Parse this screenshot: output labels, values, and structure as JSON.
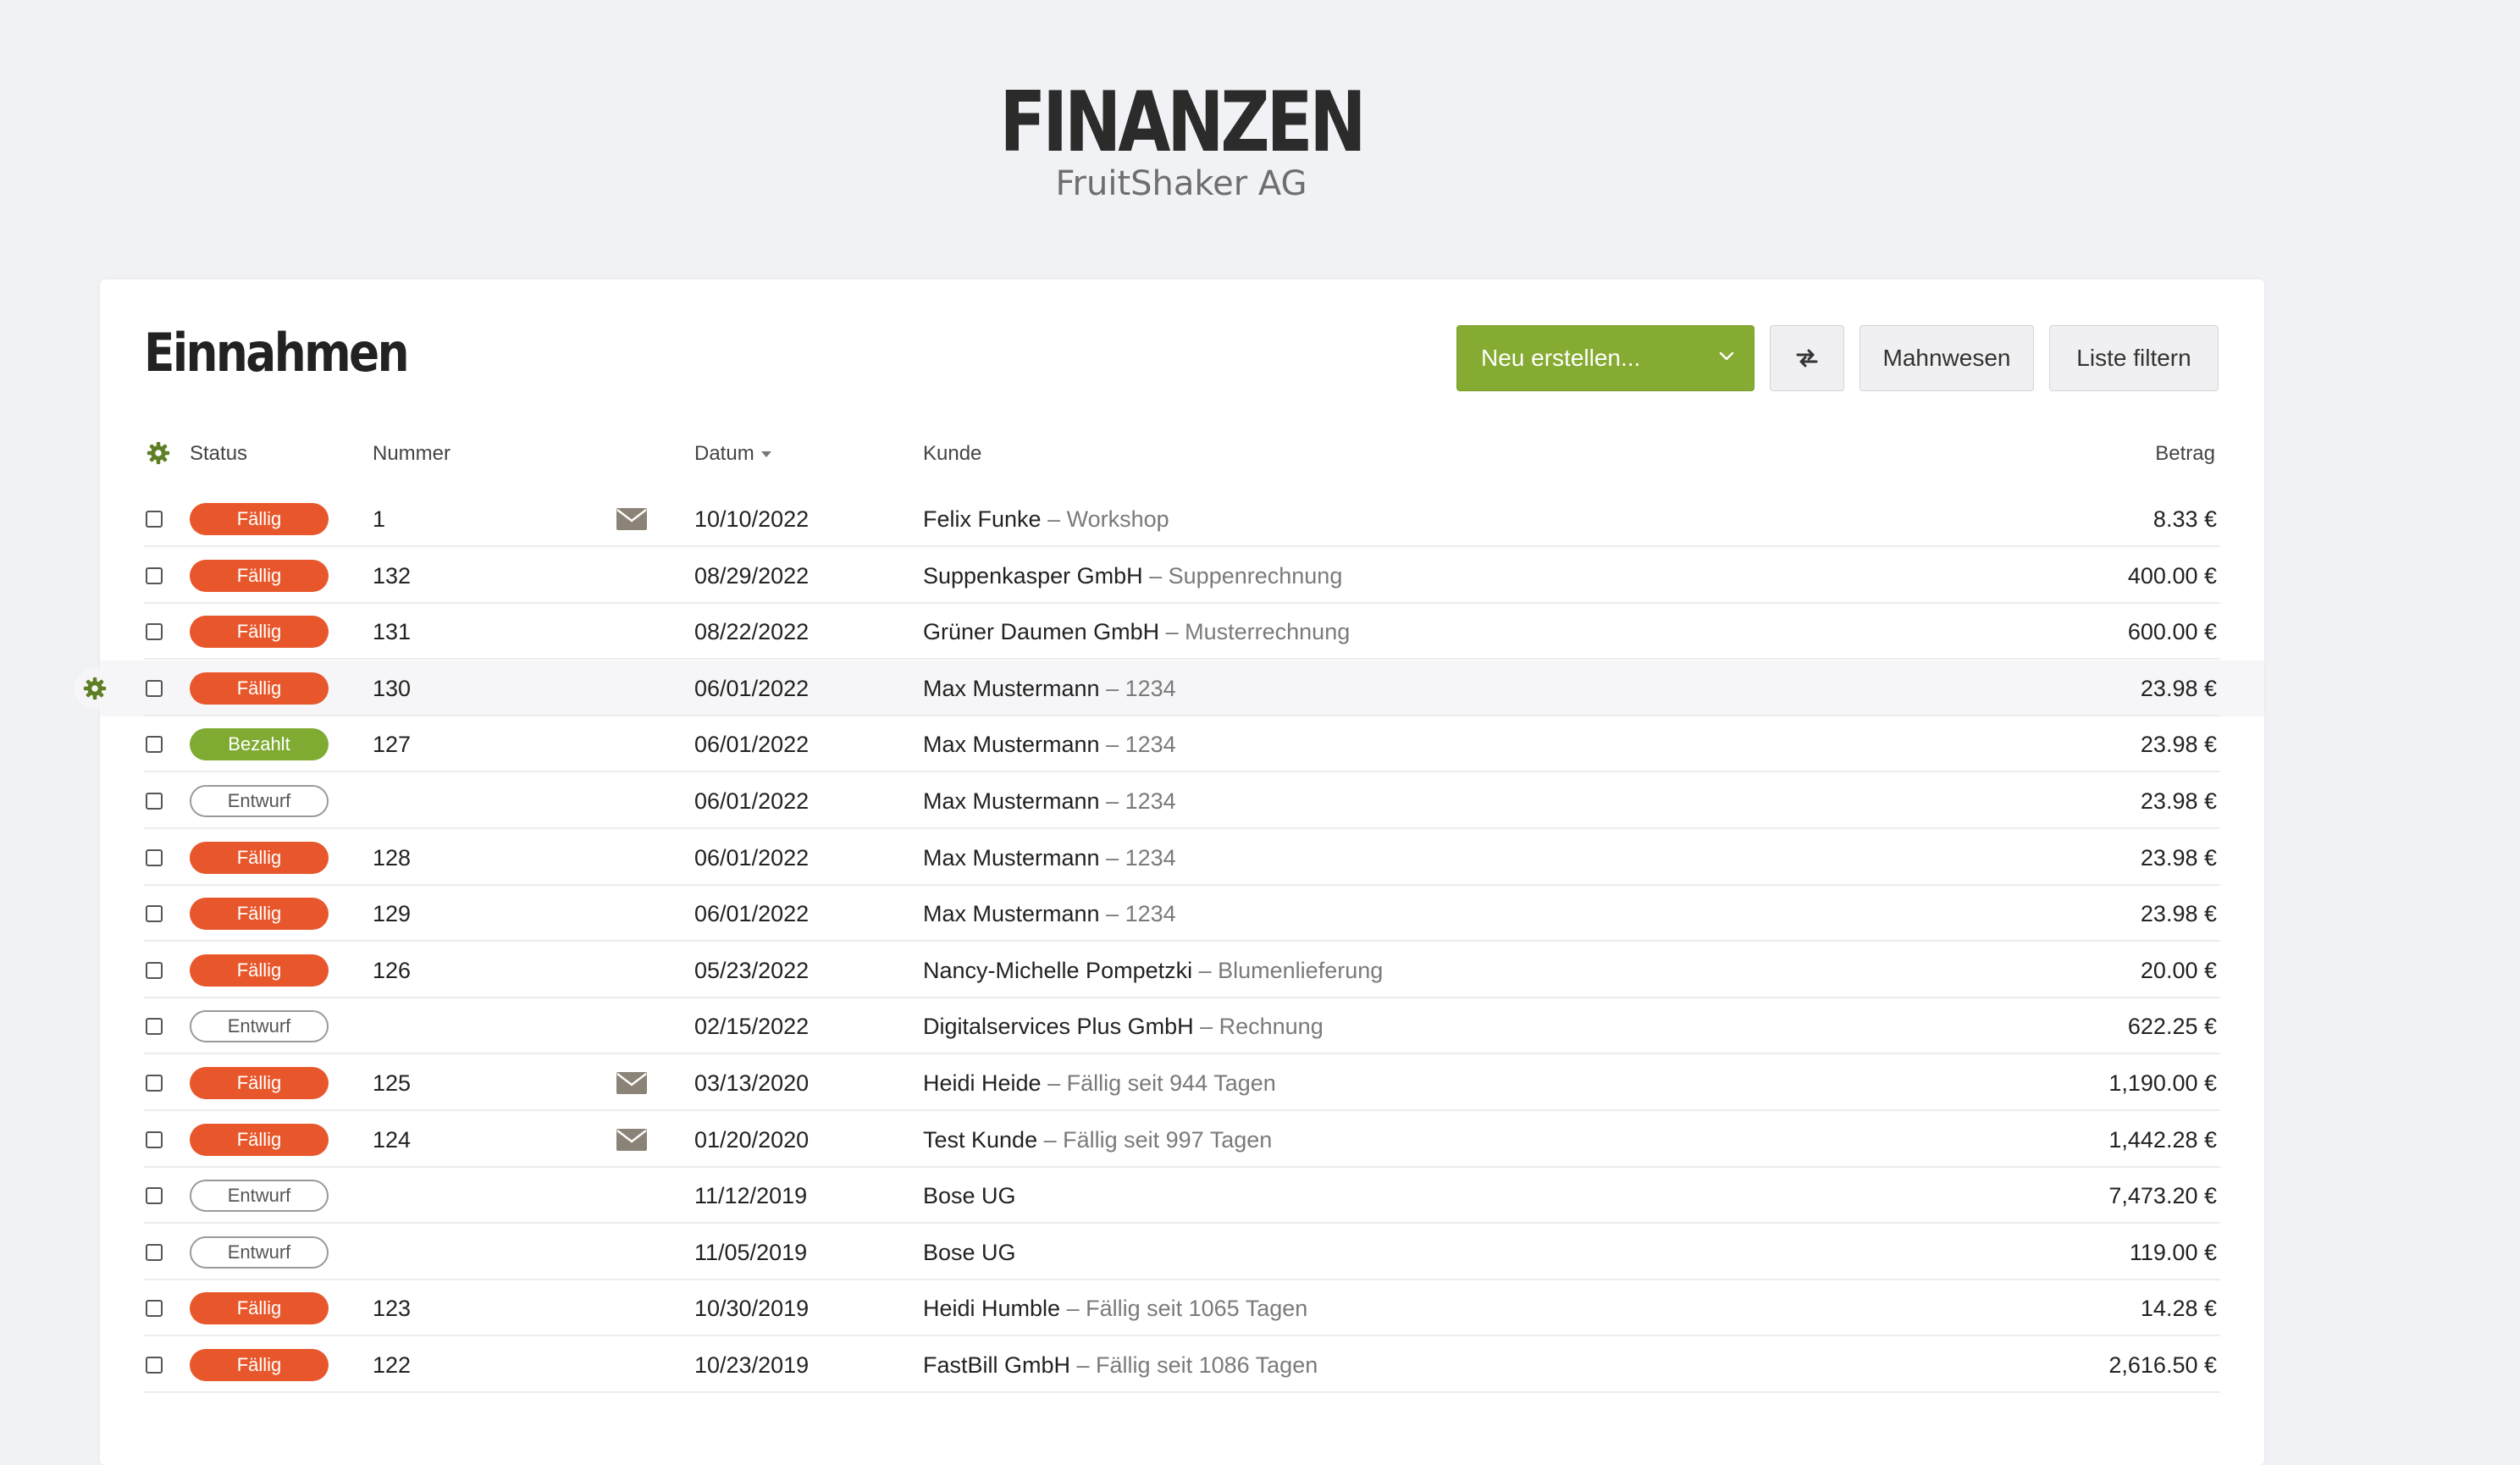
{
  "header": {
    "title": "FINANZEN",
    "subtitle": "FruitShaker AG"
  },
  "page": {
    "title": "Einnahmen",
    "accent_color": "#86ab32",
    "due_color": "#e8572b",
    "paid_color": "#7fab32"
  },
  "toolbar": {
    "create_label": "Neu erstellen...",
    "toggle_icon": "swap-arrows-icon",
    "dunning_label": "Mahnwesen",
    "filter_label": "Liste filtern"
  },
  "table": {
    "columns": {
      "status": "Status",
      "number": "Nummer",
      "date": "Datum",
      "customer": "Kunde",
      "amount": "Betrag"
    },
    "rows": [
      {
        "status": "Fällig",
        "type": "due",
        "number": "1",
        "mail": true,
        "date": "10/10/2022",
        "customer": "Felix Funke",
        "desc": " – Workshop",
        "amount": "8.33 €"
      },
      {
        "status": "Fällig",
        "type": "due",
        "number": "132",
        "mail": false,
        "date": "08/29/2022",
        "customer": "Suppenkasper GmbH",
        "desc": " – Suppenrechnung",
        "amount": "400.00 €"
      },
      {
        "status": "Fällig",
        "type": "due",
        "number": "131",
        "mail": false,
        "date": "08/22/2022",
        "customer": "Grüner Daumen GmbH",
        "desc": " – Musterrechnung",
        "amount": "600.00 €"
      },
      {
        "status": "Fällig",
        "type": "due",
        "number": "130",
        "mail": false,
        "date": "06/01/2022",
        "customer": "Max Mustermann",
        "desc": " – 1234",
        "amount": "23.98 €",
        "highlight": true
      },
      {
        "status": "Bezahlt",
        "type": "paid",
        "number": "127",
        "mail": false,
        "date": "06/01/2022",
        "customer": "Max Mustermann",
        "desc": " – 1234",
        "amount": "23.98 €"
      },
      {
        "status": "Entwurf",
        "type": "draft",
        "number": "",
        "mail": false,
        "date": "06/01/2022",
        "customer": "Max Mustermann",
        "desc": " – 1234",
        "amount": "23.98 €"
      },
      {
        "status": "Fällig",
        "type": "due",
        "number": "128",
        "mail": false,
        "date": "06/01/2022",
        "customer": "Max Mustermann",
        "desc": " – 1234",
        "amount": "23.98 €"
      },
      {
        "status": "Fällig",
        "type": "due",
        "number": "129",
        "mail": false,
        "date": "06/01/2022",
        "customer": "Max Mustermann",
        "desc": " – 1234",
        "amount": "23.98 €"
      },
      {
        "status": "Fällig",
        "type": "due",
        "number": "126",
        "mail": false,
        "date": "05/23/2022",
        "customer": "Nancy-Michelle Pompetzki",
        "desc": " – Blumenlieferung",
        "amount": "20.00 €"
      },
      {
        "status": "Entwurf",
        "type": "draft",
        "number": "",
        "mail": false,
        "date": "02/15/2022",
        "customer": "Digitalservices Plus GmbH",
        "desc": " – Rechnung",
        "amount": "622.25 €"
      },
      {
        "status": "Fällig",
        "type": "due",
        "number": "125",
        "mail": true,
        "date": "03/13/2020",
        "customer": "Heidi Heide",
        "desc": " – Fällig seit 944 Tagen",
        "amount": "1,190.00 €"
      },
      {
        "status": "Fällig",
        "type": "due",
        "number": "124",
        "mail": true,
        "date": "01/20/2020",
        "customer": "Test Kunde",
        "desc": " – Fällig seit 997 Tagen",
        "amount": "1,442.28 €"
      },
      {
        "status": "Entwurf",
        "type": "draft",
        "number": "",
        "mail": false,
        "date": "11/12/2019",
        "customer": "Bose UG",
        "desc": "",
        "amount": "7,473.20 €"
      },
      {
        "status": "Entwurf",
        "type": "draft",
        "number": "",
        "mail": false,
        "date": "11/05/2019",
        "customer": "Bose UG",
        "desc": "",
        "amount": "119.00 €"
      },
      {
        "status": "Fällig",
        "type": "due",
        "number": "123",
        "mail": false,
        "date": "10/30/2019",
        "customer": "Heidi Humble",
        "desc": " – Fällig seit 1065 Tagen",
        "amount": "14.28 €"
      },
      {
        "status": "Fällig",
        "type": "due",
        "number": "122",
        "mail": false,
        "date": "10/23/2019",
        "customer": "FastBill GmbH",
        "desc": " – Fällig seit 1086 Tagen",
        "amount": "2,616.50 €"
      }
    ]
  }
}
